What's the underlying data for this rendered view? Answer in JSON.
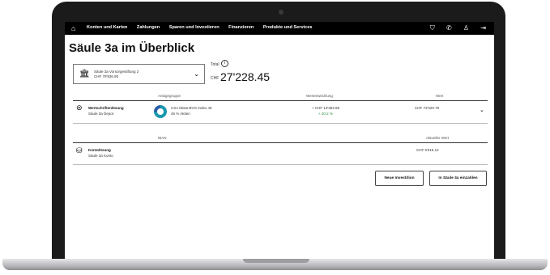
{
  "nav": {
    "items": [
      "Konten und Karten",
      "Zahlungen",
      "Sparen und Investieren",
      "Finanzieren",
      "Produkte und Services"
    ],
    "icons": [
      "home-icon",
      "shield-icon",
      "phone-icon",
      "user-icon",
      "logout-icon"
    ]
  },
  "page": {
    "title": "Säule 3a im Überblick"
  },
  "account": {
    "name": "Säule 3a Vorsorgestiftung 2",
    "balance": "CHF 79'936.90"
  },
  "total": {
    "label": "Total",
    "currency": "CHF",
    "value": "27'228.45"
  },
  "table1": {
    "headers": {
      "group": "Anlagegruppe",
      "change": "Wertentwicklung",
      "value": "Wert"
    },
    "row": {
      "name": "Wertschriftenlösung",
      "sub": "Säule 3a Depot",
      "fund": "CSA Mixta-BVG Index 45",
      "fund_sub": "45 % Aktien",
      "change_abs": "+ CHF 13'353.59",
      "change_pct": "+ 20.2 %",
      "value": "CHF 73'320.78"
    }
  },
  "table2": {
    "headers": {
      "iban": "IBAN",
      "value": "Aktueller Wert"
    },
    "row": {
      "name": "Kontolösung",
      "sub": "Säule 3a Konto",
      "value": "CHF 5'615.12"
    }
  },
  "buttons": {
    "new_investment": "Neue Investition",
    "deposit": "In Säule 3a einzahlen"
  }
}
